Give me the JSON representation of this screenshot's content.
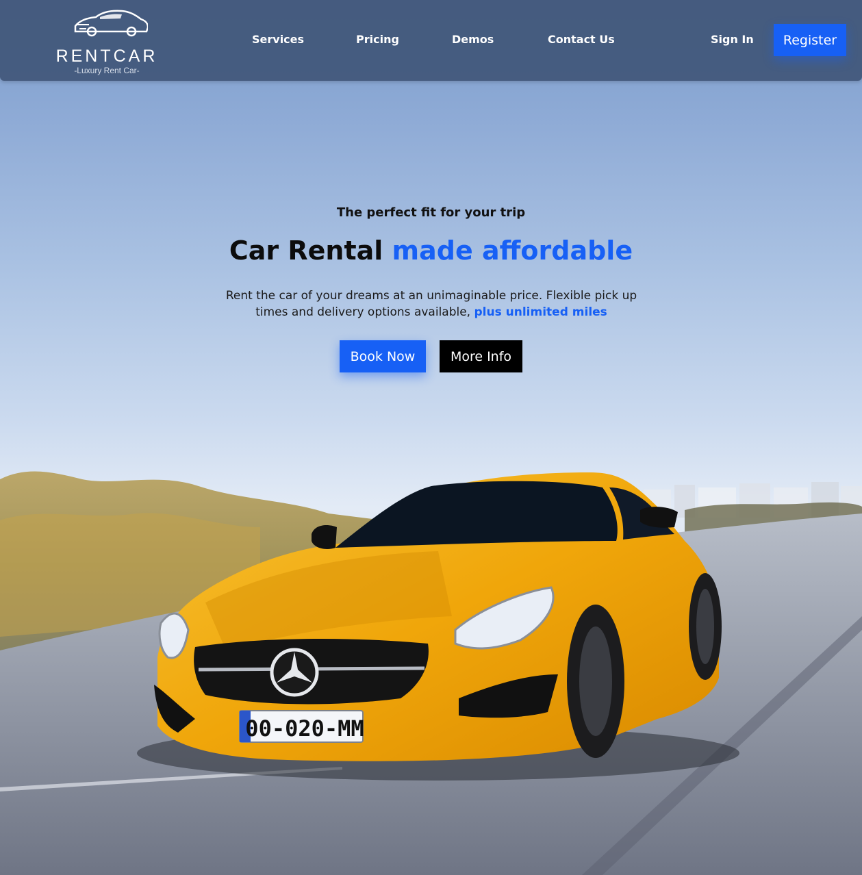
{
  "brand": {
    "name": "RENTCAR",
    "tagline": "-Luxury Rent Car-"
  },
  "nav": {
    "links": [
      "Services",
      "Pricing",
      "Demos",
      "Contact Us"
    ],
    "sign_in": "Sign In",
    "register": "Register"
  },
  "hero": {
    "eyebrow": "The perfect fit for your trip",
    "headline_plain": "Car Rental",
    "headline_accent": "made affordable",
    "subtext_plain": "Rent the car of your dreams at an unimaginable price. Flexible pick up times and delivery options available,",
    "subtext_accent": "plus unlimited miles",
    "book_button": "Book Now",
    "more_button": "More Info"
  },
  "image": {
    "plate": "00-020-MM"
  },
  "colors": {
    "accent": "#1760f5",
    "navbar": "#405678",
    "car_body": "#f5b20a"
  }
}
